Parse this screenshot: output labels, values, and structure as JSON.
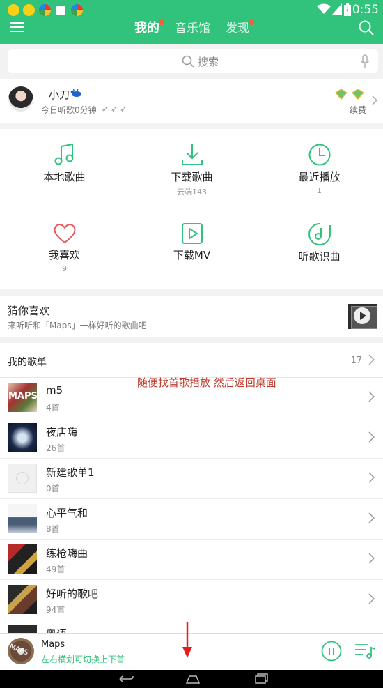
{
  "status": {
    "time": "10:55"
  },
  "header": {
    "tabs": [
      "我的",
      "音乐馆",
      "发现"
    ]
  },
  "search": {
    "placeholder": "搜索"
  },
  "profile": {
    "name": "小刀",
    "listen_today": "今日听歌0分钟",
    "renew": "续费"
  },
  "grid": [
    {
      "label": "本地歌曲",
      "sub": "",
      "icon": "music-note-icon"
    },
    {
      "label": "下载歌曲",
      "sub": "云端143",
      "icon": "download-icon"
    },
    {
      "label": "最近播放",
      "sub": "1",
      "icon": "clock-icon"
    },
    {
      "label": "我喜欢",
      "sub": "9",
      "icon": "heart-icon"
    },
    {
      "label": "下载MV",
      "sub": "",
      "icon": "video-play-icon"
    },
    {
      "label": "听歌识曲",
      "sub": "",
      "icon": "song-recognition-icon"
    }
  ],
  "recommend": {
    "title": "猜你喜欢",
    "subtitle": "来听听和「Maps」一样好听的歌曲吧"
  },
  "playlists": {
    "title": "我的歌单",
    "count": "17",
    "items": [
      {
        "name": "m5",
        "count": "4首"
      },
      {
        "name": "夜店嗨",
        "count": "26首"
      },
      {
        "name": "新建歌单1",
        "count": "0首"
      },
      {
        "name": "心平气和",
        "count": "8首"
      },
      {
        "name": "练枪嗨曲",
        "count": "49首"
      },
      {
        "name": "好听的歌吧",
        "count": "94首"
      },
      {
        "name": "粤语",
        "count": ""
      }
    ]
  },
  "overlay_hint": "随便找首歌播放 然后返回桌面",
  "player": {
    "song": "Maps",
    "tip": "左右横划可切换上下首",
    "disc_text": "MAPS"
  },
  "colors": {
    "brand_green": "#31c27c",
    "hint_red": "#c0392b"
  }
}
